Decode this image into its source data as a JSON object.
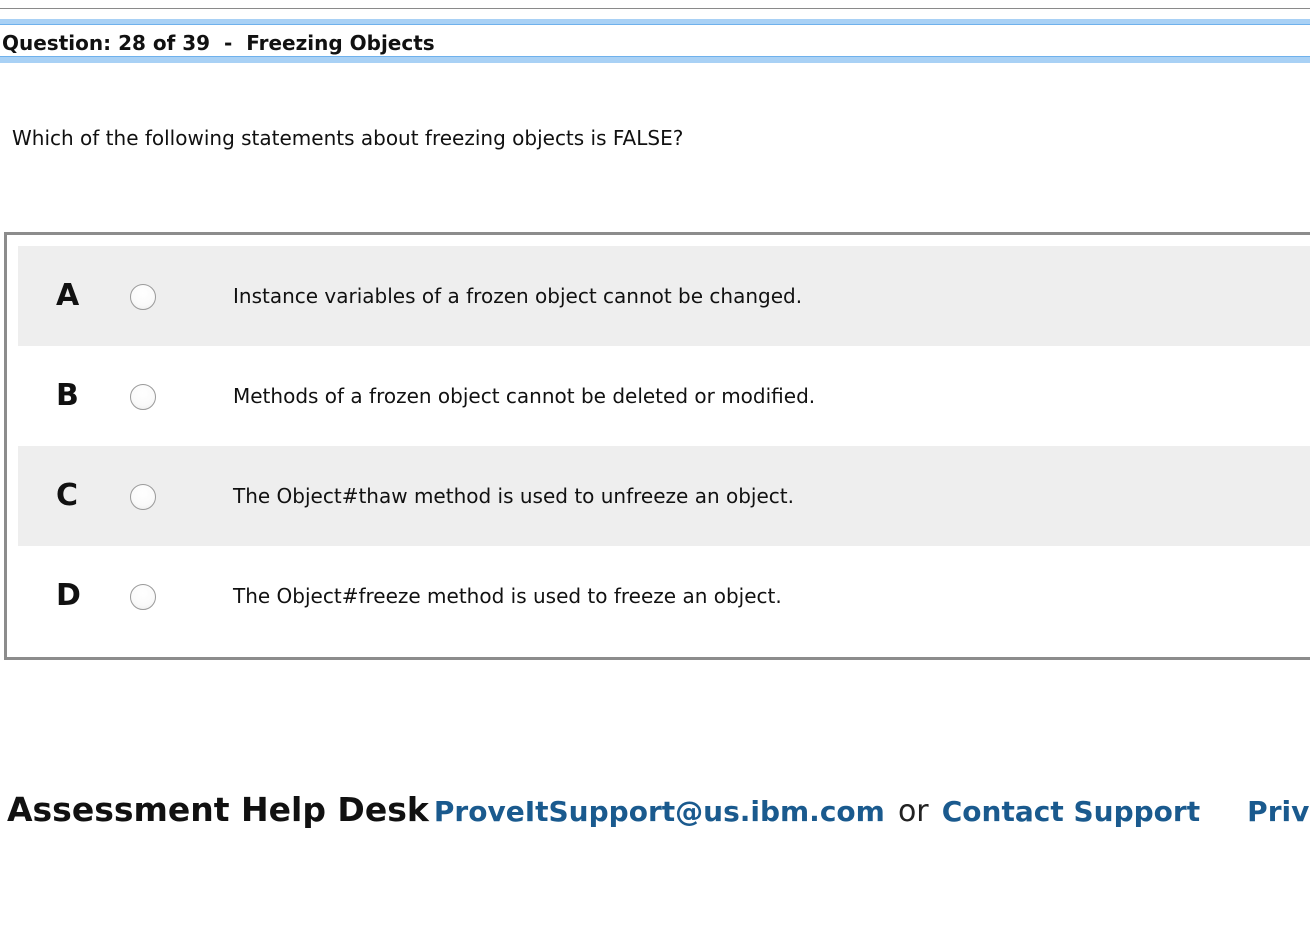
{
  "header": {
    "title": "Question: 28 of 39  -  Freezing Objects"
  },
  "question": {
    "text": "Which of the following statements about freezing objects is FALSE?"
  },
  "answers": [
    {
      "letter": "A",
      "text": "Instance variables of a frozen object cannot be changed.",
      "selected": false
    },
    {
      "letter": "B",
      "text": "Methods of a frozen object cannot be deleted or modified.",
      "selected": false
    },
    {
      "letter": "C",
      "text": "The Object#thaw method is used to unfreeze an object.",
      "selected": false
    },
    {
      "letter": "D",
      "text": "The Object#freeze method is used to freeze an object.",
      "selected": false
    }
  ],
  "footer": {
    "help_desk_label": "Assessment Help Desk",
    "email_link": "ProveItSupport@us.ibm.com",
    "or_text": "or",
    "contact_link": "Contact Support",
    "privacy_link": "Privacy"
  },
  "colors": {
    "link": "#1a5a8e",
    "header_accent": "#a9d1f5",
    "row_shade": "#eeeeee"
  }
}
